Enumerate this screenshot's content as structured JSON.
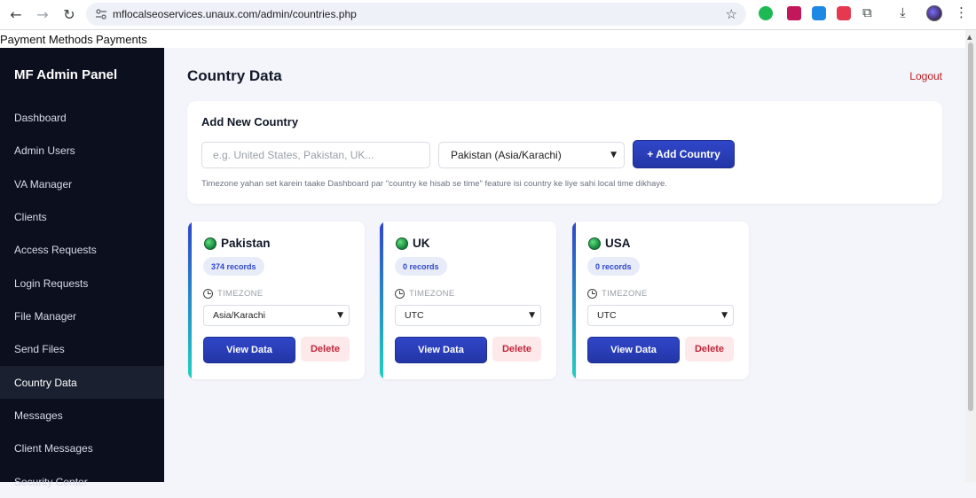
{
  "browser": {
    "url": "mflocalseoservices.unaux.com/admin/countries.php",
    "icons": [
      "back-icon",
      "forward-icon",
      "reload-icon",
      "site-info-icon",
      "bookmark-star-icon",
      "extensions-icon",
      "download-icon",
      "menu-icon"
    ]
  },
  "topnav": {
    "payment_methods": "Payment Methods",
    "payments": "Payments"
  },
  "sidebar": {
    "brand": "MF Admin Panel",
    "items": [
      {
        "label": "Dashboard"
      },
      {
        "label": "Admin Users"
      },
      {
        "label": "VA Manager"
      },
      {
        "label": "Clients"
      },
      {
        "label": "Access Requests"
      },
      {
        "label": "Login Requests"
      },
      {
        "label": "File Manager"
      },
      {
        "label": "Send Files"
      },
      {
        "label": "Country Data"
      },
      {
        "label": "Messages"
      },
      {
        "label": "Client Messages"
      },
      {
        "label": "Security Center"
      }
    ],
    "active": "Country Data"
  },
  "header": {
    "title": "Country Data",
    "logout": "Logout"
  },
  "add_form": {
    "title": "Add New Country",
    "input_placeholder": "e.g. United States, Pakistan, UK...",
    "input_value": "",
    "timezone_selected": "Pakistan (Asia/Karachi)",
    "add_button": "+ Add Country",
    "hint": "Timezone yahan set karein taake Dashboard par \"country ke hisab se time\" feature isi country ke liye sahi local time dikhaye."
  },
  "countries": [
    {
      "name": "Pakistan",
      "records": "374 records",
      "timezone_label": "TIMEZONE",
      "timezone": "Asia/Karachi",
      "view": "View Data",
      "delete": "Delete"
    },
    {
      "name": "UK",
      "records": "0 records",
      "timezone_label": "TIMEZONE",
      "timezone": "UTC",
      "view": "View Data",
      "delete": "Delete"
    },
    {
      "name": "USA",
      "records": "0 records",
      "timezone_label": "TIMEZONE",
      "timezone": "UTC",
      "view": "View Data",
      "delete": "Delete"
    }
  ],
  "colors": {
    "sidebar_bg": "#0b0f1e",
    "primary": "#2f46c9",
    "danger": "#c0283b",
    "accent_teal": "#1fd1c0"
  }
}
